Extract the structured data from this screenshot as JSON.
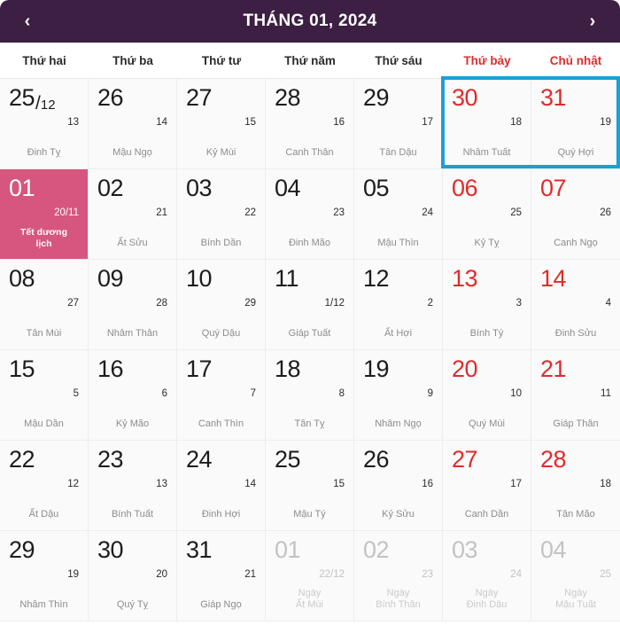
{
  "header": {
    "title": "THÁNG 01, 2024",
    "prev_label": "‹",
    "next_label": "›",
    "bg_color": "#3c1f42"
  },
  "weekdays": [
    {
      "label": "Thứ hai",
      "weekend": false
    },
    {
      "label": "Thứ ba",
      "weekend": false
    },
    {
      "label": "Thứ tư",
      "weekend": false
    },
    {
      "label": "Thứ năm",
      "weekend": false
    },
    {
      "label": "Thứ sáu",
      "weekend": false
    },
    {
      "label": "Thứ bảy",
      "weekend": true
    },
    {
      "label": "Chủ nhật",
      "weekend": true
    }
  ],
  "colors": {
    "weekend_text": "#e02b2b",
    "holiday_bg": "#d6567f",
    "selection_border": "#1a9fd9",
    "cell_bg": "#fbfafa",
    "muted_text": "#8c8c8c"
  },
  "selection": {
    "note": "Thứ bảy 30/12 – Chủ nhật 31/12"
  },
  "days": [
    {
      "solar": "25",
      "solar_month": "12",
      "lunar": "13",
      "canchi": "Đinh Tỵ",
      "weekend": false,
      "other": false,
      "holiday": false
    },
    {
      "solar": "26",
      "solar_month": "",
      "lunar": "14",
      "canchi": "Mậu Ngọ",
      "weekend": false,
      "other": false,
      "holiday": false
    },
    {
      "solar": "27",
      "solar_month": "",
      "lunar": "15",
      "canchi": "Kỷ Mùi",
      "weekend": false,
      "other": false,
      "holiday": false
    },
    {
      "solar": "28",
      "solar_month": "",
      "lunar": "16",
      "canchi": "Canh Thân",
      "weekend": false,
      "other": false,
      "holiday": false
    },
    {
      "solar": "29",
      "solar_month": "",
      "lunar": "17",
      "canchi": "Tân Dậu",
      "weekend": false,
      "other": false,
      "holiday": false
    },
    {
      "solar": "30",
      "solar_month": "",
      "lunar": "18",
      "canchi": "Nhâm Tuất",
      "weekend": true,
      "other": false,
      "holiday": false
    },
    {
      "solar": "31",
      "solar_month": "",
      "lunar": "19",
      "canchi": "Quý Hợi",
      "weekend": true,
      "other": false,
      "holiday": false
    },
    {
      "solar": "01",
      "solar_month": "",
      "lunar": "20/11",
      "canchi": "Tết dương\nlịch",
      "weekend": false,
      "other": false,
      "holiday": true
    },
    {
      "solar": "02",
      "solar_month": "",
      "lunar": "21",
      "canchi": "Ất Sửu",
      "weekend": false,
      "other": false,
      "holiday": false
    },
    {
      "solar": "03",
      "solar_month": "",
      "lunar": "22",
      "canchi": "Bính Dần",
      "weekend": false,
      "other": false,
      "holiday": false
    },
    {
      "solar": "04",
      "solar_month": "",
      "lunar": "23",
      "canchi": "Đinh Mão",
      "weekend": false,
      "other": false,
      "holiday": false
    },
    {
      "solar": "05",
      "solar_month": "",
      "lunar": "24",
      "canchi": "Mậu Thìn",
      "weekend": false,
      "other": false,
      "holiday": false
    },
    {
      "solar": "06",
      "solar_month": "",
      "lunar": "25",
      "canchi": "Kỷ Tỵ",
      "weekend": true,
      "other": false,
      "holiday": false
    },
    {
      "solar": "07",
      "solar_month": "",
      "lunar": "26",
      "canchi": "Canh Ngọ",
      "weekend": true,
      "other": false,
      "holiday": false
    },
    {
      "solar": "08",
      "solar_month": "",
      "lunar": "27",
      "canchi": "Tân Mùi",
      "weekend": false,
      "other": false,
      "holiday": false
    },
    {
      "solar": "09",
      "solar_month": "",
      "lunar": "28",
      "canchi": "Nhâm Thân",
      "weekend": false,
      "other": false,
      "holiday": false
    },
    {
      "solar": "10",
      "solar_month": "",
      "lunar": "29",
      "canchi": "Quý Dậu",
      "weekend": false,
      "other": false,
      "holiday": false
    },
    {
      "solar": "11",
      "solar_month": "",
      "lunar": "1/12",
      "canchi": "Giáp Tuất",
      "weekend": false,
      "other": false,
      "holiday": false
    },
    {
      "solar": "12",
      "solar_month": "",
      "lunar": "2",
      "canchi": "Ất Hợi",
      "weekend": false,
      "other": false,
      "holiday": false
    },
    {
      "solar": "13",
      "solar_month": "",
      "lunar": "3",
      "canchi": "Bính Tý",
      "weekend": true,
      "other": false,
      "holiday": false
    },
    {
      "solar": "14",
      "solar_month": "",
      "lunar": "4",
      "canchi": "Đinh Sửu",
      "weekend": true,
      "other": false,
      "holiday": false
    },
    {
      "solar": "15",
      "solar_month": "",
      "lunar": "5",
      "canchi": "Mậu Dần",
      "weekend": false,
      "other": false,
      "holiday": false
    },
    {
      "solar": "16",
      "solar_month": "",
      "lunar": "6",
      "canchi": "Kỷ Mão",
      "weekend": false,
      "other": false,
      "holiday": false
    },
    {
      "solar": "17",
      "solar_month": "",
      "lunar": "7",
      "canchi": "Canh Thìn",
      "weekend": false,
      "other": false,
      "holiday": false
    },
    {
      "solar": "18",
      "solar_month": "",
      "lunar": "8",
      "canchi": "Tân Tỵ",
      "weekend": false,
      "other": false,
      "holiday": false
    },
    {
      "solar": "19",
      "solar_month": "",
      "lunar": "9",
      "canchi": "Nhâm Ngọ",
      "weekend": false,
      "other": false,
      "holiday": false
    },
    {
      "solar": "20",
      "solar_month": "",
      "lunar": "10",
      "canchi": "Quý Mùi",
      "weekend": true,
      "other": false,
      "holiday": false
    },
    {
      "solar": "21",
      "solar_month": "",
      "lunar": "11",
      "canchi": "Giáp Thân",
      "weekend": true,
      "other": false,
      "holiday": false
    },
    {
      "solar": "22",
      "solar_month": "",
      "lunar": "12",
      "canchi": "Ất Dậu",
      "weekend": false,
      "other": false,
      "holiday": false
    },
    {
      "solar": "23",
      "solar_month": "",
      "lunar": "13",
      "canchi": "Bính Tuất",
      "weekend": false,
      "other": false,
      "holiday": false
    },
    {
      "solar": "24",
      "solar_month": "",
      "lunar": "14",
      "canchi": "Đinh Hợi",
      "weekend": false,
      "other": false,
      "holiday": false
    },
    {
      "solar": "25",
      "solar_month": "",
      "lunar": "15",
      "canchi": "Mậu Tý",
      "weekend": false,
      "other": false,
      "holiday": false
    },
    {
      "solar": "26",
      "solar_month": "",
      "lunar": "16",
      "canchi": "Kỷ Sửu",
      "weekend": false,
      "other": false,
      "holiday": false
    },
    {
      "solar": "27",
      "solar_month": "",
      "lunar": "17",
      "canchi": "Canh Dần",
      "weekend": true,
      "other": false,
      "holiday": false
    },
    {
      "solar": "28",
      "solar_month": "",
      "lunar": "18",
      "canchi": "Tân Mão",
      "weekend": true,
      "other": false,
      "holiday": false
    },
    {
      "solar": "29",
      "solar_month": "",
      "lunar": "19",
      "canchi": "Nhâm Thìn",
      "weekend": false,
      "other": false,
      "holiday": false
    },
    {
      "solar": "30",
      "solar_month": "",
      "lunar": "20",
      "canchi": "Quý Tỵ",
      "weekend": false,
      "other": false,
      "holiday": false
    },
    {
      "solar": "31",
      "solar_month": "",
      "lunar": "21",
      "canchi": "Giáp Ngọ",
      "weekend": false,
      "other": false,
      "holiday": false
    },
    {
      "solar": "01",
      "solar_month": "",
      "lunar": "22/12",
      "canchi": "Ngày\nẤt Mùi",
      "weekend": false,
      "other": true,
      "holiday": false
    },
    {
      "solar": "02",
      "solar_month": "",
      "lunar": "23",
      "canchi": "Ngày\nBính Thân",
      "weekend": false,
      "other": true,
      "holiday": false
    },
    {
      "solar": "03",
      "solar_month": "",
      "lunar": "24",
      "canchi": "Ngày\nĐinh Dậu",
      "weekend": true,
      "other": true,
      "holiday": false
    },
    {
      "solar": "04",
      "solar_month": "",
      "lunar": "25",
      "canchi": "Ngày\nMậu Tuất",
      "weekend": true,
      "other": true,
      "holiday": false
    }
  ]
}
